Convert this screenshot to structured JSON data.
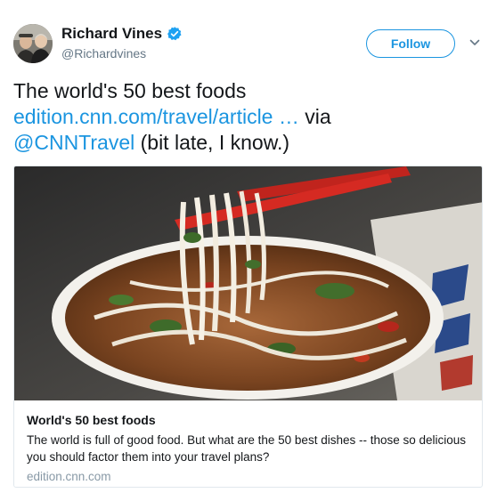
{
  "user": {
    "name": "Richard Vines",
    "handle": "@Richardvines",
    "avatar_icon": "user-avatar-photo",
    "verified_icon": "verified-badge-icon",
    "verified_color": "#1da1f2"
  },
  "actions": {
    "follow_label": "Follow",
    "menu_icon": "chevron-down-icon"
  },
  "tweet": {
    "text_prefix": "The world's 50 best foods",
    "link_text": "edition.cnn.com/travel/article …",
    "via_text": " via",
    "mention": "@CNNTravel",
    "suffix": " (bit late, I know.)"
  },
  "card": {
    "image_icon": "food-photo-noodle-soup",
    "title": "World's 50 best foods",
    "description": "The world is full of good food. But what are the 50 best dishes -- those so delicious you should factor them into your travel plans?",
    "domain": "edition.cnn.com"
  },
  "colors": {
    "link": "#1b95e0",
    "text": "#14171a",
    "muted": "#657786",
    "border": "#e1e8ed"
  }
}
